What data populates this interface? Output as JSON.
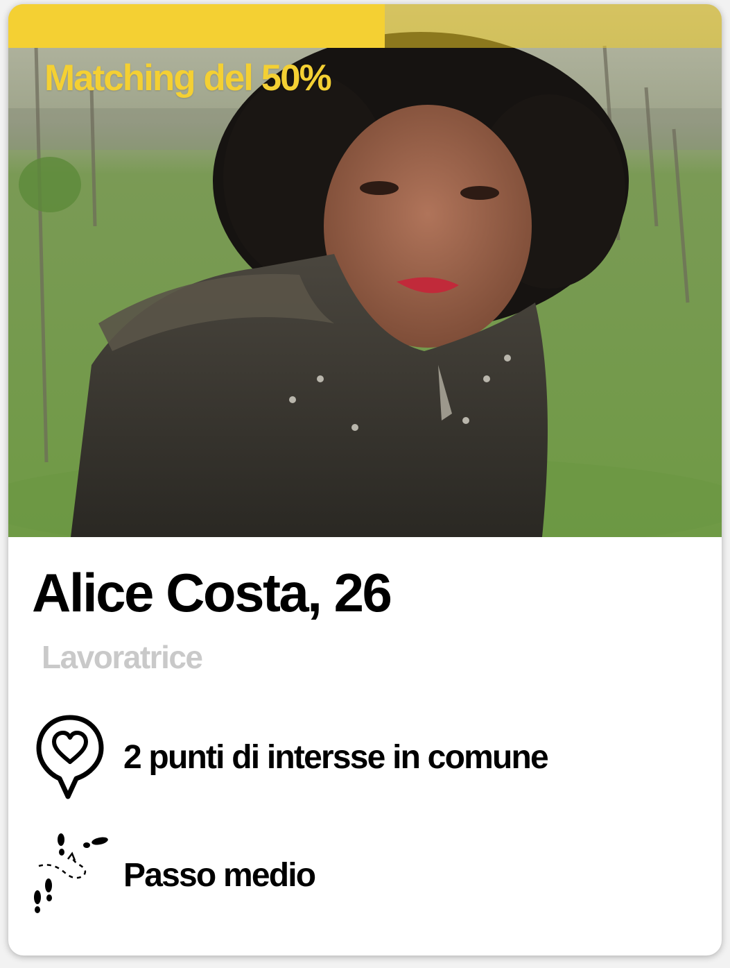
{
  "match": {
    "label": "Matching del 50%",
    "percent": 50
  },
  "profile": {
    "name_age": "Alice Costa, 26",
    "occupation": "Lavoratrice"
  },
  "details": {
    "interests_text": "2 punti di intersse in comune",
    "interests_icon": "heart-location-pin-icon",
    "pace_text": "Passo medio",
    "pace_icon": "footsteps-icon"
  },
  "colors": {
    "accent_yellow": "#f4d033",
    "text_primary": "#000000",
    "text_secondary": "#c9c9c9"
  }
}
